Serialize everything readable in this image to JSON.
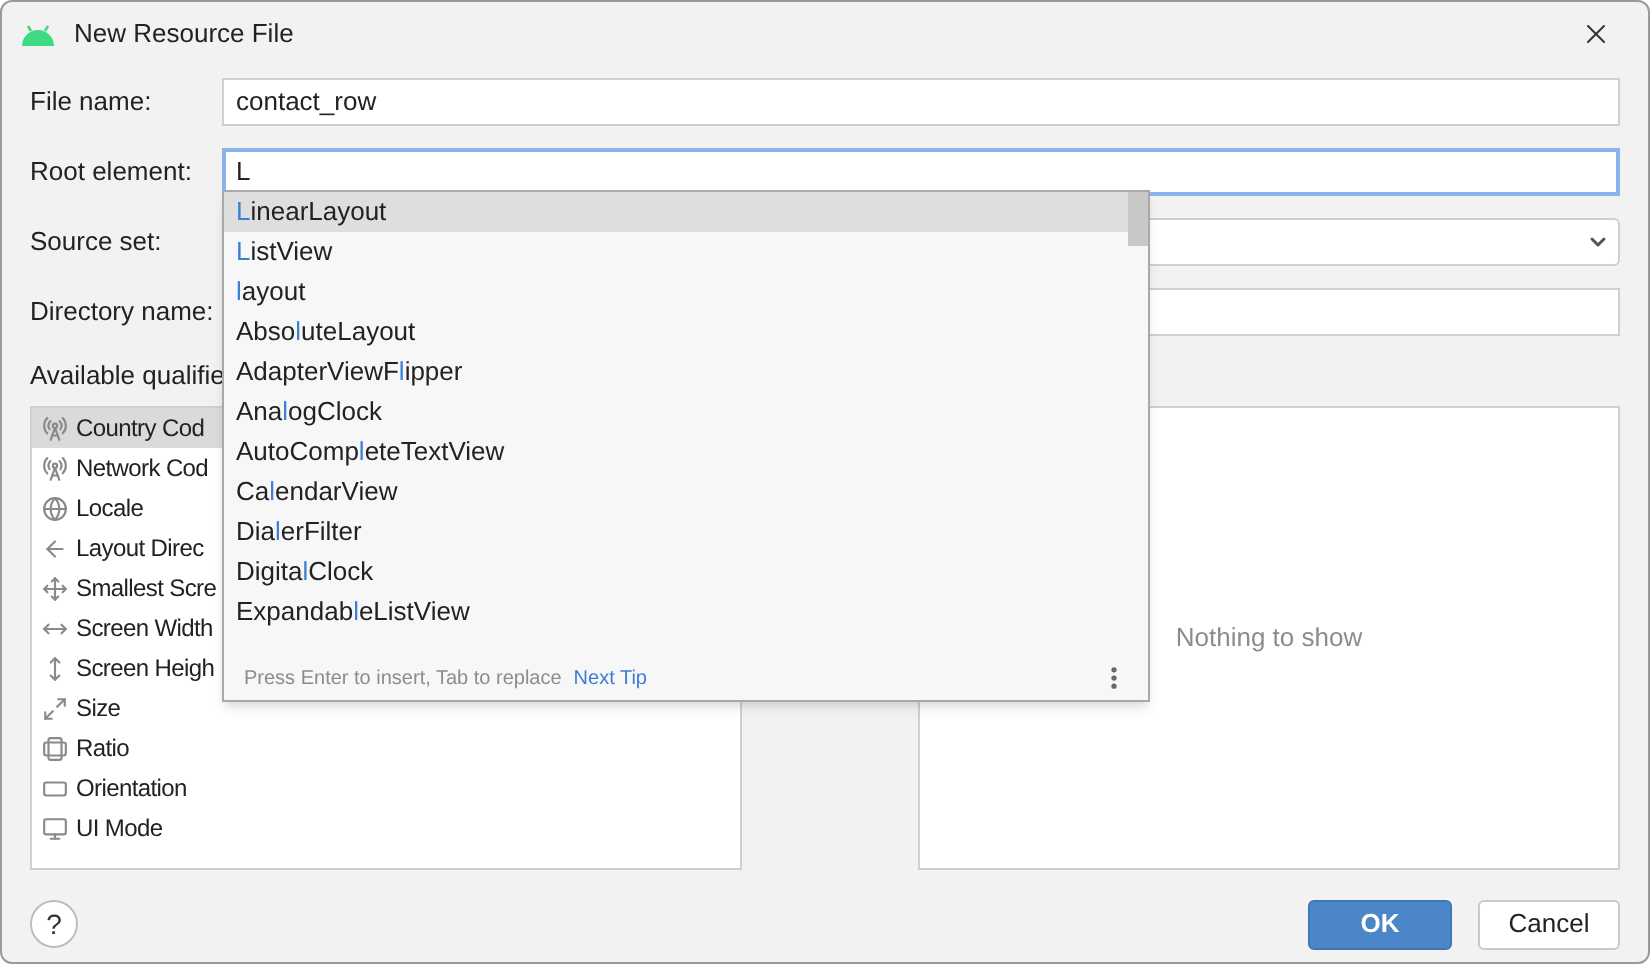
{
  "window": {
    "title": "New Resource File"
  },
  "fields": [
    {
      "kind": "text",
      "label": "File name:",
      "value": "contact_row",
      "focused": false
    },
    {
      "kind": "text",
      "label": "Root element:",
      "value": "L",
      "focused": true
    },
    {
      "kind": "dropdown",
      "label": "Source set:"
    },
    {
      "kind": "text",
      "label": "Directory name:",
      "focused": false
    }
  ],
  "qualifiers": {
    "label": "Available qualifie",
    "items": [
      {
        "label": "Country Cod",
        "selected": true
      },
      {
        "label": "Network Cod",
        "selected": false
      },
      {
        "label": "Locale",
        "selected": false
      },
      {
        "label": "Layout Direc",
        "selected": false
      },
      {
        "label": "Smallest Scre",
        "selected": false
      },
      {
        "label": "Screen Width",
        "selected": false
      },
      {
        "label": "Screen Heigh",
        "selected": false
      },
      {
        "label": "Size",
        "selected": false
      },
      {
        "label": "Ratio",
        "selected": false
      },
      {
        "label": "Orientation",
        "selected": false
      },
      {
        "label": "UI Mode",
        "selected": false
      }
    ]
  },
  "chosen": {
    "empty_text": "Nothing to show"
  },
  "completion": {
    "items": [
      {
        "match": "L",
        "suffix": "inearLayout",
        "selected": true
      },
      {
        "match": "L",
        "suffix": "istView",
        "selected": false
      },
      {
        "match": "l",
        "suffix": "ayout",
        "selected": false
      },
      {
        "prefix": "Abso",
        "match": "l",
        "suffix": "uteLayout",
        "selected": false
      },
      {
        "prefix": "AdapterViewF",
        "match": "l",
        "suffix": "ipper",
        "selected": false
      },
      {
        "prefix": "Ana",
        "match": "l",
        "suffix": "ogClock",
        "selected": false
      },
      {
        "prefix": "AutoComp",
        "match": "l",
        "suffix": "eteTextView",
        "selected": false
      },
      {
        "prefix": "Ca",
        "match": "l",
        "suffix": "endarView",
        "selected": false
      },
      {
        "prefix": "Dia",
        "match": "l",
        "suffix": "erFilter",
        "selected": false
      },
      {
        "prefix": "Digita",
        "match": "l",
        "suffix": "Clock",
        "selected": false
      },
      {
        "prefix": "Expandab",
        "match": "l",
        "suffix": "eListView",
        "selected": false
      }
    ],
    "hint": "Press Enter to insert, Tab to replace",
    "link": "Next Tip"
  },
  "help": "?",
  "buttons": [
    {
      "label": "OK",
      "kind": "primary"
    },
    {
      "label": "Cancel",
      "kind": "secondary"
    }
  ]
}
